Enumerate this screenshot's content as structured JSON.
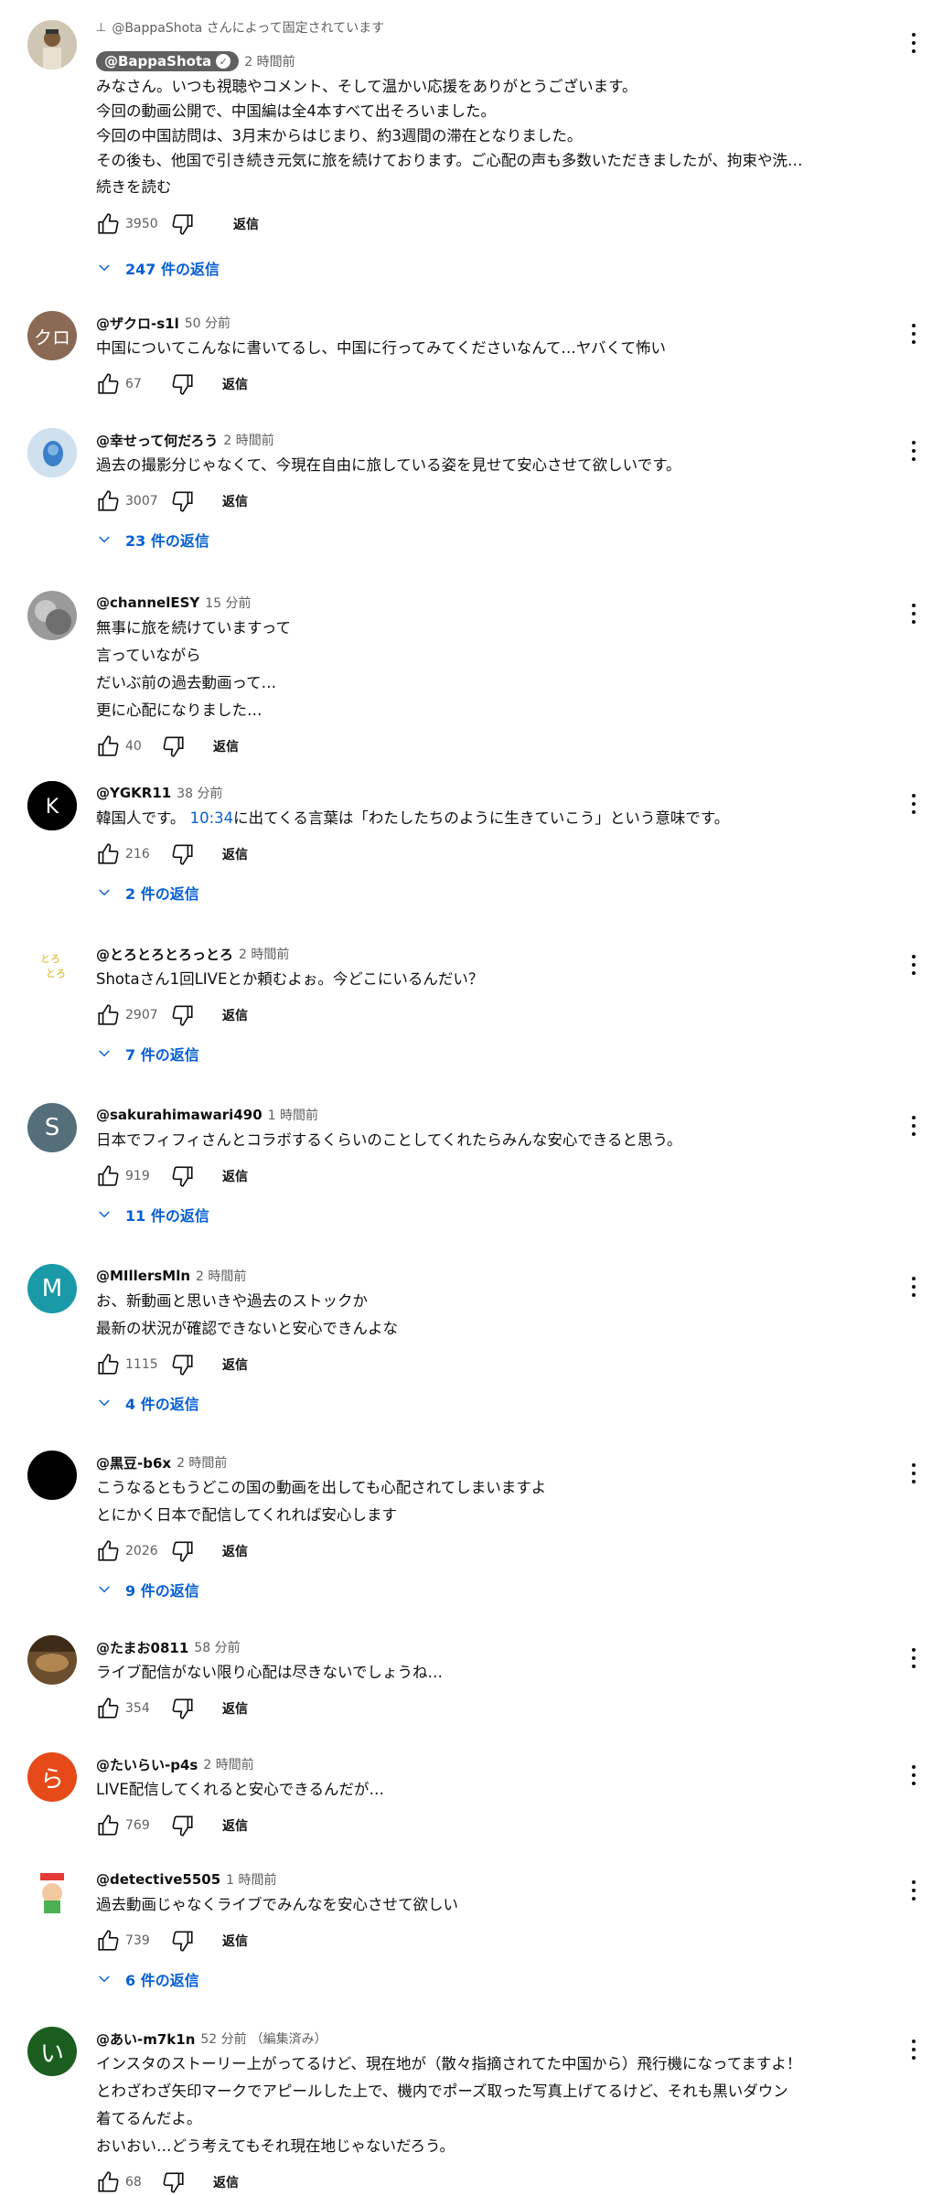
{
  "pinned": {
    "text": "@BappaShota さんによって固定されています"
  },
  "comments": [
    {
      "author": "@BappaShota",
      "time": "2 時間前",
      "lines": [
        "みなさん。いつも視聴やコメント、そして温かい応援をありがとうございます。",
        "今回の動画公開で、中国編は全4本すべて出そろいました。",
        "今回の中国訪問は、3月末からはじまり、約3週間の滞在となりました。",
        "その後も、他国で引き続き元気に旅を続けております。ご心配の声も多数いただきましたが、拘束や洗…"
      ],
      "readmore": "続きを読む",
      "likes": "3950",
      "reply": "返信",
      "replies": "247 件の返信"
    },
    {
      "author": "@ザクロ-s1l",
      "time": "50 分前",
      "avatar_text": "クロ",
      "lines": [
        "中国についてこんなに書いてるし、中国に行ってみてくださいなんて…ヤバくて怖い"
      ],
      "likes": "67",
      "reply": "返信"
    },
    {
      "author": "@幸せって何だろう",
      "time": "2 時間前",
      "lines": [
        "過去の撮影分じゃなくて、今現在自由に旅している姿を見せて安心させて欲しいです。"
      ],
      "likes": "3007",
      "reply": "返信",
      "replies": "23 件の返信"
    },
    {
      "author": "@channelESY",
      "time": "15 分前",
      "lines": [
        "無事に旅を続けていますって",
        "言っていながら",
        "だいぶ前の過去動画って…",
        "更に心配になりました…"
      ],
      "likes": "40",
      "reply": "返信"
    },
    {
      "author": "@YGKR11",
      "time": "38 分前",
      "lines_pre": "韓国人です。 ",
      "timestamp": "10:34",
      "lines_post": "に出てくる言葉は「わたしたちのように生きていこう」という意味です。",
      "likes": "216",
      "reply": "返信",
      "replies": "2 件の返信"
    },
    {
      "author": "@とろとろとろっとろ",
      "time": "2 時間前",
      "lines": [
        "Shotaさん1回LIVEとか頼むよぉ。今どこにいるんだい？"
      ],
      "likes": "2907",
      "reply": "返信",
      "replies": "7 件の返信"
    },
    {
      "author": "@sakurahimawari490",
      "time": "1 時間前",
      "avatar_text": "S",
      "lines": [
        "日本でフィフィさんとコラボするくらいのことしてくれたらみんな安心できると思う。"
      ],
      "likes": "919",
      "reply": "返信",
      "replies": "11 件の返信"
    },
    {
      "author": "@MIllersMln",
      "time": "2 時間前",
      "avatar_text": "M",
      "lines": [
        "お、新動画と思いきや過去のストックか",
        "最新の状況が確認できないと安心できんよな"
      ],
      "likes": "1115",
      "reply": "返信",
      "replies": "4 件の返信"
    },
    {
      "author": "@黒豆-b6x",
      "time": "2 時間前",
      "lines": [
        "こうなるともうどこの国の動画を出しても心配されてしまいますよ",
        "とにかく日本で配信してくれれば安心します"
      ],
      "likes": "2026",
      "reply": "返信",
      "replies": "9 件の返信"
    },
    {
      "author": "@たまお0811",
      "time": "58 分前",
      "lines": [
        "ライブ配信がない限り心配は尽きないでしょうね…"
      ],
      "likes": "354",
      "reply": "返信"
    },
    {
      "author": "@たいらい-p4s",
      "time": "2 時間前",
      "avatar_text": "ら",
      "lines": [
        "LIVE配信してくれると安心できるんだが…"
      ],
      "likes": "769",
      "reply": "返信"
    },
    {
      "author": "@detective5505",
      "time": "1 時間前",
      "lines": [
        "過去動画じゃなくライブでみんなを安心させて欲しい"
      ],
      "likes": "739",
      "reply": "返信",
      "replies": "6 件の返信"
    },
    {
      "author": "@あい-m7k1n",
      "time": "52 分前",
      "edited": "（編集済み）",
      "avatar_text": "い",
      "lines": [
        "インスタのストーリー上がってるけど、現在地が（散々指摘されてた中国から）飛行機になってますよ！",
        "とわざわざ矢印マークでアピールした上で、機内でポーズ取った写真上げてるけど、それも黒いダウン",
        "着てるんだよ。",
        "おいおい…どう考えてもそれ現在地じゃないだろう。"
      ],
      "likes": "68",
      "reply": "返信"
    }
  ],
  "colors": {
    "link": "#065fd4",
    "secondary": "#606060",
    "text": "#0f0f0f"
  }
}
